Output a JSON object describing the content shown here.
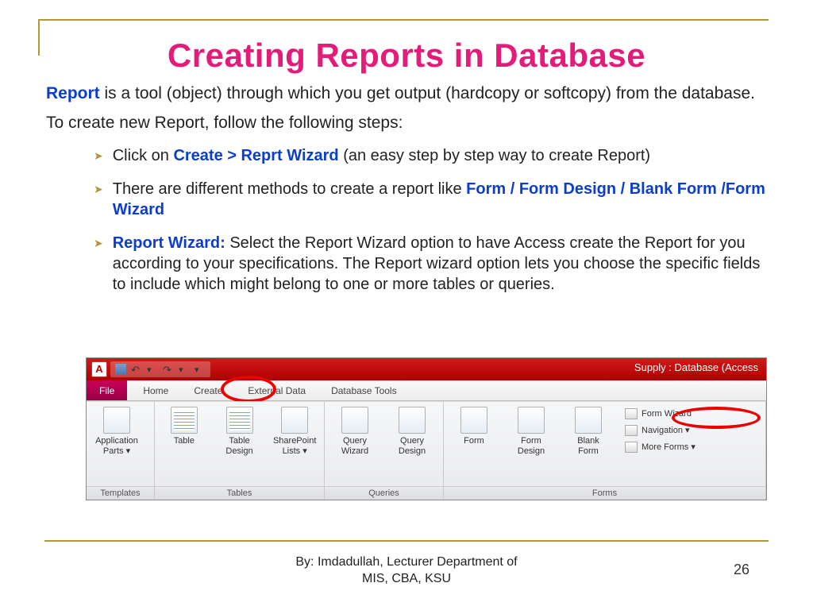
{
  "title": "Creating Reports in Database",
  "para1": {
    "lead": "Report",
    "rest": "  is a tool (object) through which you get output (hardcopy or softcopy) from the database."
  },
  "para2": "To create new Report, follow the following steps:",
  "bullets": [
    {
      "pre": "Click on ",
      "hl": "Create > Reprt Wizard",
      "post": " (an easy step by step way to create Report)"
    },
    {
      "pre": "There are different methods to create a report like ",
      "hl": "Form / Form Design / Blank Form  /Form Wizard",
      "post": ""
    },
    {
      "lead": "Report Wizard:",
      "body": " Select the Report Wizard option to have Access create the Report for you according to your specifications. The Report wizard option lets you choose the specific fields to include which might belong to one or more tables or queries."
    }
  ],
  "ribbon": {
    "app_letter": "A",
    "title_text": "Supply : Database (Access",
    "tabs": {
      "file": "File",
      "home": "Home",
      "create": "Create",
      "ext": "External Data",
      "tools": "Database Tools"
    },
    "groups": {
      "templates": {
        "label": "Templates",
        "items": {
          "app_parts": "Application\nParts ▾"
        }
      },
      "tables": {
        "label": "Tables",
        "items": {
          "table": "Table",
          "table_design": "Table\nDesign",
          "sp_lists": "SharePoint\nLists ▾"
        }
      },
      "queries": {
        "label": "Queries",
        "items": {
          "q_wizard": "Query\nWizard",
          "q_design": "Query\nDesign"
        }
      },
      "forms": {
        "label": "Forms",
        "items": {
          "form": "Form",
          "form_design": "Form\nDesign",
          "blank_form": "Blank\nForm"
        },
        "extra": {
          "form_wizard": "Form Wizard",
          "navigation": "Navigation ▾",
          "more_forms": "More Forms ▾"
        }
      }
    }
  },
  "footer": {
    "by": "By: Imdadullah, Lecturer Department of",
    "aff": "MIS, CBA, KSU",
    "page": "26"
  }
}
